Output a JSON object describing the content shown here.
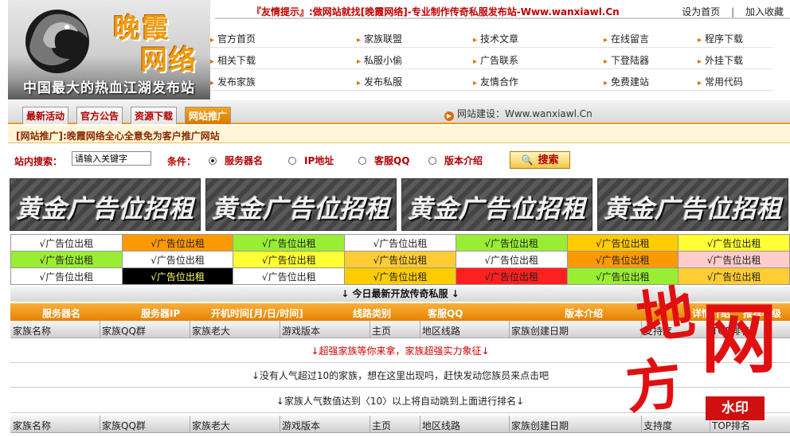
{
  "header": {
    "brand_line1": "晚霞",
    "brand_line2": "网络",
    "slogan": "中国最大的热血江湖发布站",
    "notice": "『友情提示』:做网站就找[晚霞网络]-专业制作传奇私服发布站-Www.wanxiawl.Cn",
    "set_home": "设为首页",
    "separator": "|",
    "add_favorite": "加入收藏"
  },
  "nav": [
    [
      "官方首页",
      "家族联盟",
      "技术文章",
      "在线留言",
      "程序下载"
    ],
    [
      "相关下载",
      "私服小偷",
      "广告联系",
      "下登陆器",
      "外挂下载"
    ],
    [
      "发布家族",
      "发布私服",
      "友情合作",
      "免费建站",
      "常用代码"
    ]
  ],
  "tabs": [
    "最新活动",
    "官方公告",
    "资源下载",
    "网站推广"
  ],
  "build_label": "网站建设：Www.wanxiawl.Cn",
  "promo": "[网站推广]:晚霞网络全心全意免为客户推广网站",
  "search": {
    "label": "站内搜索：",
    "input_value": "请输入关键字",
    "condition_label": "条件：",
    "options": [
      "服务器名",
      "IP地址",
      "客服QQ",
      "版本介绍"
    ],
    "button": "搜索"
  },
  "banners": [
    "黄金广告位招租",
    "黄金广告位招租",
    "黄金广告位招租",
    "黄金广告位招租"
  ],
  "ad_grid": {
    "label": "√广告位出租",
    "colors": [
      [
        "#ffffff",
        "#ff9900",
        "#99ee33",
        "#ffffff",
        "#99ee33",
        "#ffcc00",
        "#ffff33"
      ],
      [
        "#99ee33",
        "#ffffff",
        "#ffff33",
        "#ffcc33",
        "#ffffff",
        "#ff9900",
        "#ffcccc"
      ],
      [
        "#ffffff",
        "#000000",
        "#ffffff",
        "#ffcc00",
        "#ff2020",
        "#99ee33",
        "#ffcc33"
      ]
    ]
  },
  "today_title": "↓ 今日最新开放传奇私服 ↓",
  "table_headers": [
    "服务器名",
    "服务器IP",
    "开机时间[月/日/时间]",
    "线路类别",
    "客服QQ",
    "版本介绍",
    "详情介绍",
    "推荐等级"
  ],
  "family_columns": [
    "家族名称",
    "家族QQ群",
    "家族老大",
    "游戏版本",
    "主页",
    "地区线路",
    "家族创建日期",
    "支持度",
    "TOP排名"
  ],
  "messages": {
    "m1": "↓超强家族等你来拿，家族超强实力象征↓",
    "m2": "↓没有人气超过10的家族，想在这里出现吗，赶快发动您族员来点击吧",
    "m3": "↓家族人气数值达到〈10〉以上将自动跳到上面进行排名↓"
  },
  "watermark": {
    "c1": "地",
    "c2": "网",
    "c3": "方",
    "badge": "水印"
  }
}
